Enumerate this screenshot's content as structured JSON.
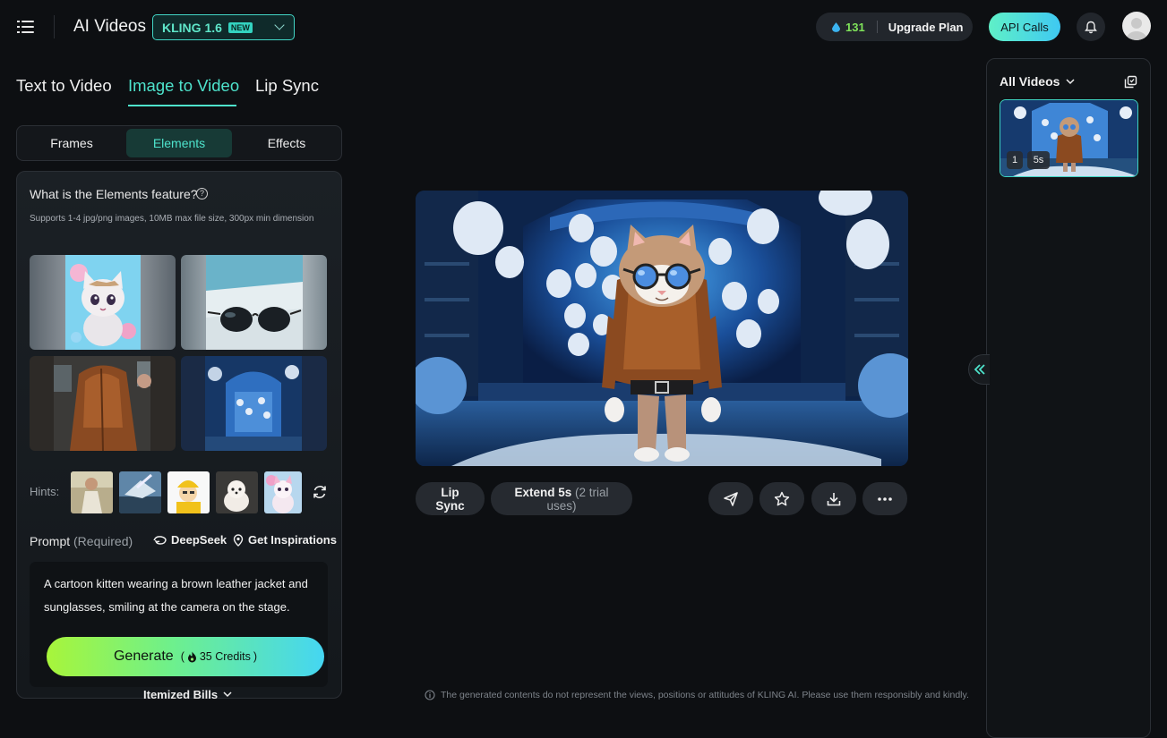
{
  "header": {
    "app_title": "AI Videos",
    "model": "KLING 1.6",
    "model_badge": "NEW",
    "credits": "131",
    "upgrade_label": "Upgrade Plan",
    "api_label": "API Calls"
  },
  "mode_tabs": [
    {
      "label": "Text to Video",
      "active": false
    },
    {
      "label": "Image to Video",
      "active": true
    },
    {
      "label": "Lip Sync",
      "active": false
    }
  ],
  "sub_tabs": [
    {
      "label": "Frames",
      "active": false
    },
    {
      "label": "Elements",
      "active": true
    },
    {
      "label": "Effects",
      "active": false
    }
  ],
  "elements_panel": {
    "title": "What is the Elements feature?",
    "help_glyph": "?",
    "subtitle": "Supports 1-4 jpg/png images, 10MB max file size, 300px min dimension",
    "hints_label": "Hints:",
    "prompt_label": "Prompt",
    "prompt_required": "(Required)",
    "deepseek_label": "DeepSeek",
    "inspire_label": "Get Inspirations",
    "prompt_text": "A cartoon kitten wearing a brown leather jacket and sunglasses, smiling at the camera on the stage.",
    "generate_label": "Generate",
    "generate_credits": "35 Credits",
    "credits_open": "(",
    "credits_close": ")",
    "itemized_label": "Itemized Bills"
  },
  "actions": {
    "lipsync_label": "Lip Sync",
    "extend_label": "Extend 5s",
    "extend_note": "(2 trial uses)"
  },
  "disclaimer": "The generated contents do not represent the views, positions or attitudes of KLING AI. Please use them responsibly and kindly.",
  "right_panel": {
    "filter_label": "All Videos",
    "thumb_count": "1",
    "thumb_duration": "5s"
  },
  "colors": {
    "accent": "#4ee3cc",
    "background": "#0d0f12",
    "credits_green": "#7fe35a"
  }
}
